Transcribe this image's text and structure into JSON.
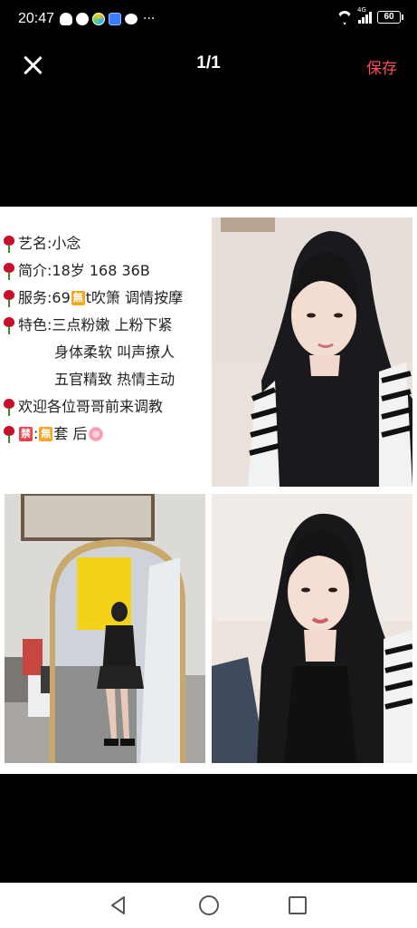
{
  "status_bar": {
    "time": "20:47",
    "more": "···",
    "signal_label": "4G",
    "battery": "60",
    "icons": [
      "qq-icon",
      "message-icon",
      "browser-icon",
      "app-icon",
      "wechat-icon"
    ]
  },
  "top_bar": {
    "page_counter": "1/1",
    "save_label": "保存",
    "save_color": "#ff4d5e"
  },
  "caption": {
    "line1": "艺名:小念",
    "line2": "简介:18岁  168  36B",
    "line3_prefix": "服务:69 ",
    "line3_badge": "無",
    "line3_suffix": "t吹箫 调情按摩",
    "line4": "特色:三点粉嫩 上粉下紧",
    "line5": "身体柔软 叫声撩人",
    "line6": "五官精致 热情主动",
    "line7": " 欢迎各位哥哥前来调教",
    "line8_badge1": "禁",
    "line8_colon": ":",
    "line8_badge2": "無",
    "line8_suffix": "套 后"
  },
  "photos": [
    "photo-portrait-1",
    "photo-mirror-selfie",
    "photo-portrait-2"
  ],
  "nav_bar": {
    "icons": [
      "back-icon",
      "home-icon",
      "recent-apps-icon"
    ]
  }
}
